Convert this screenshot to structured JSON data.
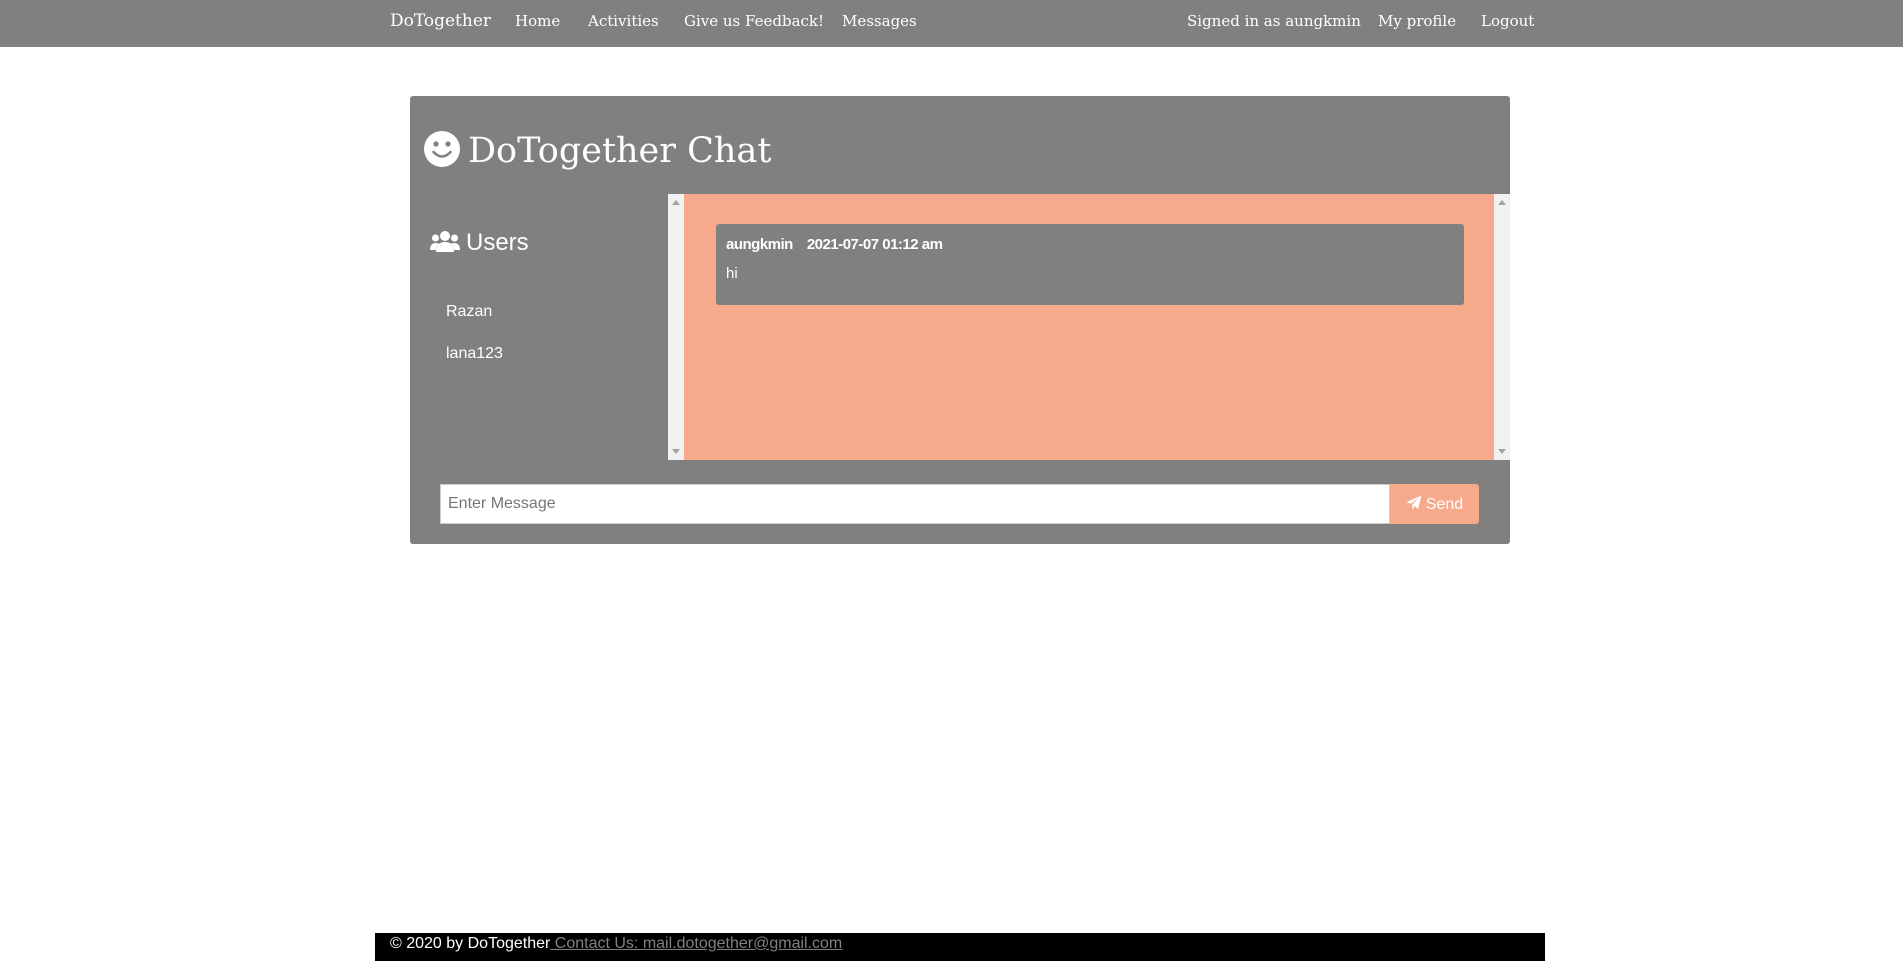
{
  "navbar": {
    "brand": "DoTogether",
    "links": [
      "Home",
      "Activities",
      "Give us Feedback!",
      "Messages"
    ],
    "signed_in": "Signed in as aungkmin",
    "profile": "My profile",
    "logout": "Logout"
  },
  "chat": {
    "title": "DoTogether Chat",
    "users_heading": "Users",
    "users": [
      "Razan",
      "lana123"
    ],
    "messages": [
      {
        "author": "aungkmin",
        "time": "2021-07-07 01:12 am",
        "text": "hi"
      }
    ],
    "input_placeholder": "Enter Message",
    "send_label": "Send"
  },
  "footer": {
    "copyright": "© 2020 by DoTogether",
    "contact": " Contact Us: mail.dotogether@gmail.com"
  },
  "colors": {
    "primary_gray": "#808080",
    "accent_salmon": "#f7a98b",
    "footer_black": "#000000"
  },
  "icons": {
    "title": "smile-icon",
    "users": "users-icon",
    "send": "paper-plane-icon"
  }
}
